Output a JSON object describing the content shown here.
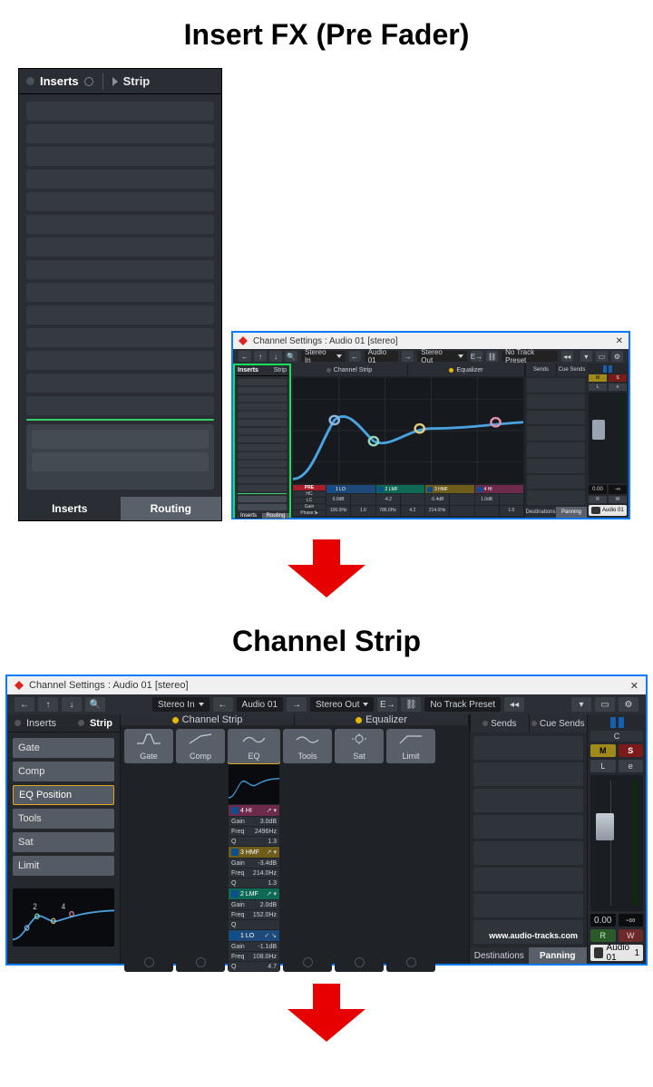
{
  "headings": {
    "section1": "Insert FX (Pre Fader)",
    "section2": "Channel Strip"
  },
  "inserts_zoom": {
    "tab_inserts": "Inserts",
    "tab_strip": "Strip",
    "footer_a": "Inserts",
    "footer_b": "Routing"
  },
  "small_window": {
    "title": "Channel Settings : Audio 01 [stereo]",
    "toolbar": {
      "input": "Stereo In",
      "track": "Audio 01",
      "output": "Stereo Out",
      "preset": "No Track Preset"
    },
    "inserts": {
      "tab_a": "Inserts",
      "tab_b": "Strip",
      "foot_a": "Inserts",
      "foot_b": "Routing"
    },
    "mid": {
      "tab_a": "Channel Strip",
      "tab_b": "Equalizer",
      "pre": {
        "label_pre": "PRE",
        "hc": "HC",
        "lc": "LC",
        "gain": "Gain",
        "phase": "Phase f▸"
      },
      "bands": {
        "lo": {
          "name": "1 LO",
          "gain": "0.0dB",
          "freq": "106.0Hz",
          "q": "1.0"
        },
        "lmf": {
          "name": "2 LMF",
          "gain": "-4.2",
          "freq": "786.0Hz",
          "q": "4.2"
        },
        "hmf": {
          "name": "3 HMF",
          "gain": "-5.4dB",
          "freq": "214.0Hz",
          "q": ""
        },
        "hi": {
          "name": "4 HI",
          "gain": "1.0dB",
          "freq": "",
          "q": "1.0"
        }
      }
    },
    "sends": {
      "tab_a": "Sends",
      "tab_b": "Cue Sends",
      "foot_a": "Destinations",
      "foot_b": "Panning"
    },
    "fader": {
      "m": "M",
      "s": "S",
      "l": "L",
      "e": "e",
      "value": "0.00",
      "peak": "-∞",
      "r": "R",
      "w": "W",
      "track_name": "Audio 01"
    }
  },
  "large_window": {
    "title": "Channel Settings : Audio 01 [stereo]",
    "toolbar": {
      "input": "Stereo In",
      "track": "Audio 01",
      "output": "Stereo Out",
      "preset": "No Track Preset"
    },
    "strip_side": {
      "tab_a": "Inserts",
      "tab_b": "Strip",
      "items": [
        "Gate",
        "Comp",
        "EQ Position",
        "Tools",
        "Sat",
        "Limit"
      ]
    },
    "mods_head": {
      "a": "Channel Strip",
      "b": "Equalizer"
    },
    "modules": {
      "gate": "Gate",
      "comp": "Comp",
      "eq": "EQ",
      "tools": "Tools",
      "sat": "Sat",
      "limit": "Limit"
    },
    "eq_bands": {
      "hi": {
        "name": "4 HI",
        "gain_l": "Gain",
        "gain_v": "3.0dB",
        "freq_l": "Freq",
        "freq_v": "2496Hz",
        "q_l": "Q",
        "q_v": "1.3"
      },
      "hmf": {
        "name": "3 HMF",
        "gain_l": "Gain",
        "gain_v": "-3.4dB",
        "freq_l": "Freq",
        "freq_v": "214.0Hz",
        "q_l": "Q",
        "q_v": "1.3"
      },
      "lmf": {
        "name": "2 LMF",
        "gain_l": "Gain",
        "gain_v": "2.0dB",
        "freq_l": "Freq",
        "freq_v": "152.0Hz",
        "q_l": "Q",
        "q_v": ""
      },
      "lo": {
        "name": "1 LO",
        "gain_l": "Gain",
        "gain_v": "-1.1dB",
        "freq_l": "Freq",
        "freq_v": "108.0Hz",
        "q_l": "Q",
        "q_v": "4.7"
      }
    },
    "sends": {
      "tab_a": "Sends",
      "tab_b": "Cue Sends",
      "foot_a": "Destinations",
      "foot_b": "Panning",
      "watermark": "www.audio-tracks.com"
    },
    "fader": {
      "c": "C",
      "m": "M",
      "s": "S",
      "l": "L",
      "e": "e",
      "value": "0.00",
      "peak": "-∞",
      "r": "R",
      "w": "W",
      "track_name": "Audio 01",
      "track_num": "1"
    }
  }
}
